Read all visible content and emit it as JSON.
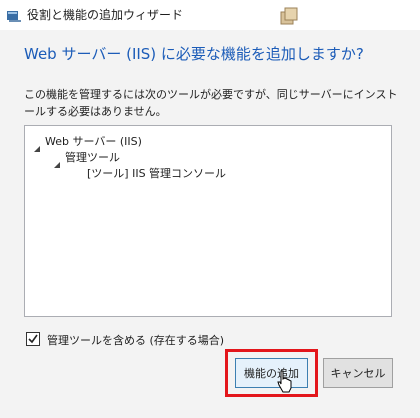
{
  "window": {
    "title": "役割と機能の追加ウィザード"
  },
  "dialog": {
    "heading": "Web サーバー (IIS) に必要な機能を追加しますか?",
    "description": "この機能を管理するには次のツールが必要ですが、同じサーバーにインストールする必要はありません。"
  },
  "tree": {
    "items": [
      {
        "label": "Web サーバー (IIS)"
      },
      {
        "label": "管理ツール"
      },
      {
        "label": "[ツール] IIS 管理コンソール"
      }
    ]
  },
  "options": {
    "include_tools_label": "管理ツールを含める (存在する場合)",
    "include_tools_checked": true
  },
  "buttons": {
    "add_label": "機能の追加",
    "cancel_label": "キャンセル"
  },
  "colors": {
    "heading": "#1c5cb8",
    "highlight_border": "#e3161b"
  }
}
